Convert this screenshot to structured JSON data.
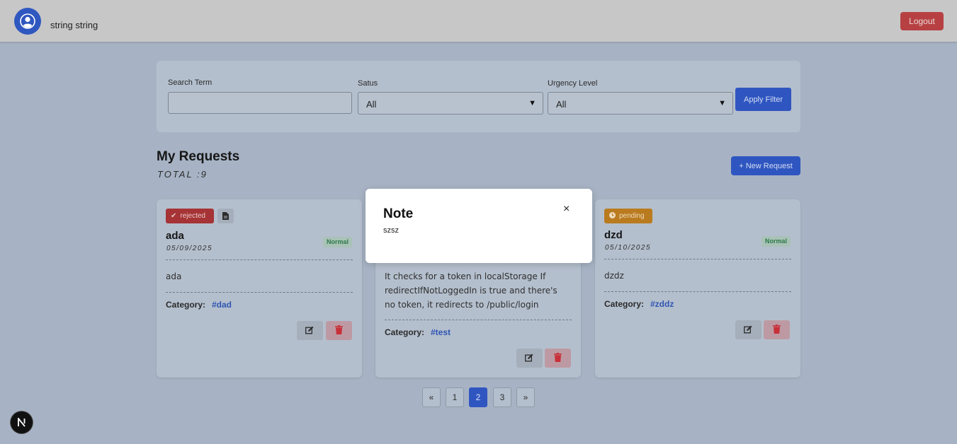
{
  "header": {
    "username": "string string",
    "logout_label": "Logout"
  },
  "filters": {
    "search_label": "Search Term",
    "search_value": "",
    "status_label": "Satus",
    "status_value": "All",
    "urgency_label": "Urgency Level",
    "urgency_value": "All",
    "apply_label": "Apply Filter"
  },
  "requests": {
    "title": "My Requests",
    "total": "TOTAL :9",
    "new_label": "+ New Request",
    "category_label": "Category:",
    "cards": [
      {
        "status": "rejected",
        "status_icon": "check-icon",
        "title": "ada",
        "date": "05/09/2025",
        "urgency": "Normal",
        "description": "ada",
        "category": "#dad"
      },
      {
        "description": "It checks for a token in localStorage If redirectIfNotLoggedIn is true and there's no token, it redirects to /public/login",
        "category": "#test"
      },
      {
        "status": "pending",
        "status_icon": "clock-icon",
        "title": "dzd",
        "date": "05/10/2025",
        "urgency": "Normal",
        "description": "dzdz",
        "category": "#zddz"
      }
    ]
  },
  "pagination": {
    "prev": "«",
    "pages": [
      "1",
      "2",
      "3"
    ],
    "active_page": "2",
    "next": "»"
  },
  "modal": {
    "title": "Note",
    "body": "szsz",
    "close": "×"
  },
  "colors": {
    "primary": "#2f56c0",
    "danger": "#b74142",
    "pending": "#ba7b1f",
    "normal_urgency": "#2c7a47"
  }
}
